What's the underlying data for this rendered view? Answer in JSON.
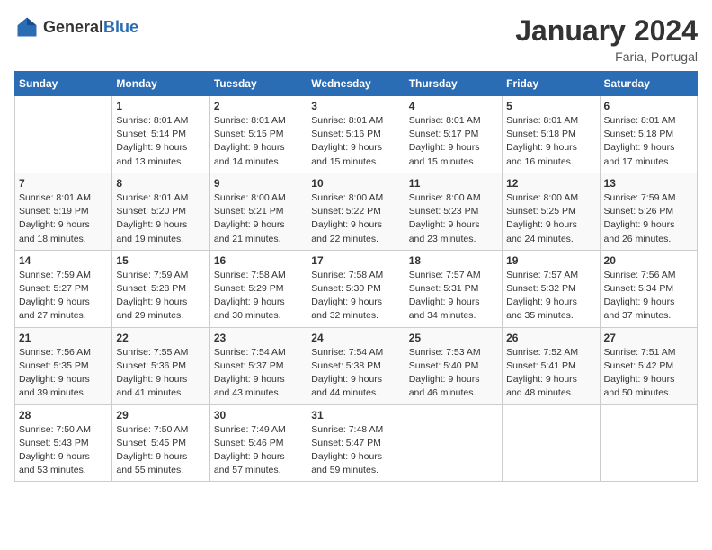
{
  "header": {
    "logo_general": "General",
    "logo_blue": "Blue",
    "month_title": "January 2024",
    "location": "Faria, Portugal"
  },
  "days_of_week": [
    "Sunday",
    "Monday",
    "Tuesday",
    "Wednesday",
    "Thursday",
    "Friday",
    "Saturday"
  ],
  "weeks": [
    [
      {
        "day": "",
        "info": ""
      },
      {
        "day": "1",
        "info": "Sunrise: 8:01 AM\nSunset: 5:14 PM\nDaylight: 9 hours\nand 13 minutes."
      },
      {
        "day": "2",
        "info": "Sunrise: 8:01 AM\nSunset: 5:15 PM\nDaylight: 9 hours\nand 14 minutes."
      },
      {
        "day": "3",
        "info": "Sunrise: 8:01 AM\nSunset: 5:16 PM\nDaylight: 9 hours\nand 15 minutes."
      },
      {
        "day": "4",
        "info": "Sunrise: 8:01 AM\nSunset: 5:17 PM\nDaylight: 9 hours\nand 15 minutes."
      },
      {
        "day": "5",
        "info": "Sunrise: 8:01 AM\nSunset: 5:18 PM\nDaylight: 9 hours\nand 16 minutes."
      },
      {
        "day": "6",
        "info": "Sunrise: 8:01 AM\nSunset: 5:18 PM\nDaylight: 9 hours\nand 17 minutes."
      }
    ],
    [
      {
        "day": "7",
        "info": "Sunrise: 8:01 AM\nSunset: 5:19 PM\nDaylight: 9 hours\nand 18 minutes."
      },
      {
        "day": "8",
        "info": "Sunrise: 8:01 AM\nSunset: 5:20 PM\nDaylight: 9 hours\nand 19 minutes."
      },
      {
        "day": "9",
        "info": "Sunrise: 8:00 AM\nSunset: 5:21 PM\nDaylight: 9 hours\nand 21 minutes."
      },
      {
        "day": "10",
        "info": "Sunrise: 8:00 AM\nSunset: 5:22 PM\nDaylight: 9 hours\nand 22 minutes."
      },
      {
        "day": "11",
        "info": "Sunrise: 8:00 AM\nSunset: 5:23 PM\nDaylight: 9 hours\nand 23 minutes."
      },
      {
        "day": "12",
        "info": "Sunrise: 8:00 AM\nSunset: 5:25 PM\nDaylight: 9 hours\nand 24 minutes."
      },
      {
        "day": "13",
        "info": "Sunrise: 7:59 AM\nSunset: 5:26 PM\nDaylight: 9 hours\nand 26 minutes."
      }
    ],
    [
      {
        "day": "14",
        "info": "Sunrise: 7:59 AM\nSunset: 5:27 PM\nDaylight: 9 hours\nand 27 minutes."
      },
      {
        "day": "15",
        "info": "Sunrise: 7:59 AM\nSunset: 5:28 PM\nDaylight: 9 hours\nand 29 minutes."
      },
      {
        "day": "16",
        "info": "Sunrise: 7:58 AM\nSunset: 5:29 PM\nDaylight: 9 hours\nand 30 minutes."
      },
      {
        "day": "17",
        "info": "Sunrise: 7:58 AM\nSunset: 5:30 PM\nDaylight: 9 hours\nand 32 minutes."
      },
      {
        "day": "18",
        "info": "Sunrise: 7:57 AM\nSunset: 5:31 PM\nDaylight: 9 hours\nand 34 minutes."
      },
      {
        "day": "19",
        "info": "Sunrise: 7:57 AM\nSunset: 5:32 PM\nDaylight: 9 hours\nand 35 minutes."
      },
      {
        "day": "20",
        "info": "Sunrise: 7:56 AM\nSunset: 5:34 PM\nDaylight: 9 hours\nand 37 minutes."
      }
    ],
    [
      {
        "day": "21",
        "info": "Sunrise: 7:56 AM\nSunset: 5:35 PM\nDaylight: 9 hours\nand 39 minutes."
      },
      {
        "day": "22",
        "info": "Sunrise: 7:55 AM\nSunset: 5:36 PM\nDaylight: 9 hours\nand 41 minutes."
      },
      {
        "day": "23",
        "info": "Sunrise: 7:54 AM\nSunset: 5:37 PM\nDaylight: 9 hours\nand 43 minutes."
      },
      {
        "day": "24",
        "info": "Sunrise: 7:54 AM\nSunset: 5:38 PM\nDaylight: 9 hours\nand 44 minutes."
      },
      {
        "day": "25",
        "info": "Sunrise: 7:53 AM\nSunset: 5:40 PM\nDaylight: 9 hours\nand 46 minutes."
      },
      {
        "day": "26",
        "info": "Sunrise: 7:52 AM\nSunset: 5:41 PM\nDaylight: 9 hours\nand 48 minutes."
      },
      {
        "day": "27",
        "info": "Sunrise: 7:51 AM\nSunset: 5:42 PM\nDaylight: 9 hours\nand 50 minutes."
      }
    ],
    [
      {
        "day": "28",
        "info": "Sunrise: 7:50 AM\nSunset: 5:43 PM\nDaylight: 9 hours\nand 53 minutes."
      },
      {
        "day": "29",
        "info": "Sunrise: 7:50 AM\nSunset: 5:45 PM\nDaylight: 9 hours\nand 55 minutes."
      },
      {
        "day": "30",
        "info": "Sunrise: 7:49 AM\nSunset: 5:46 PM\nDaylight: 9 hours\nand 57 minutes."
      },
      {
        "day": "31",
        "info": "Sunrise: 7:48 AM\nSunset: 5:47 PM\nDaylight: 9 hours\nand 59 minutes."
      },
      {
        "day": "",
        "info": ""
      },
      {
        "day": "",
        "info": ""
      },
      {
        "day": "",
        "info": ""
      }
    ]
  ]
}
